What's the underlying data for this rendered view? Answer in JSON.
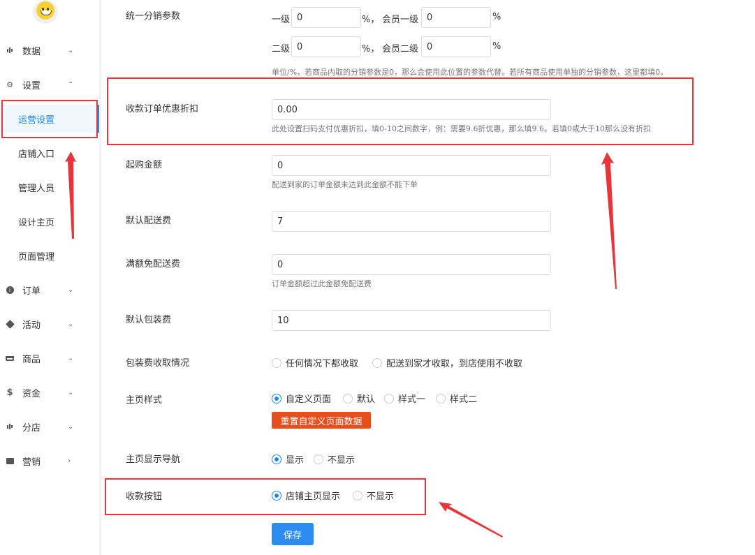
{
  "sidebar": {
    "items": [
      {
        "label": "数据",
        "icon": "bar-chart-icon"
      },
      {
        "label": "设置",
        "icon": "gear-icon"
      },
      {
        "label": "订单",
        "icon": "info-icon"
      },
      {
        "label": "活动",
        "icon": "tag-icon"
      },
      {
        "label": "商品",
        "icon": "basket-icon"
      },
      {
        "label": "资金",
        "icon": "dollar-icon"
      },
      {
        "label": "分店",
        "icon": "bar-chart-icon"
      },
      {
        "label": "营销",
        "icon": "folder-icon"
      }
    ],
    "subitems": [
      "运营设置",
      "店铺入口",
      "管理人员",
      "设计主页",
      "页面管理"
    ],
    "active_subitem": "运营设置"
  },
  "form": {
    "distribution": {
      "label": "统一分销参数",
      "level1_label": "一级",
      "level1_value": "0",
      "member_level1_label": "会员一级",
      "member_level1_value": "0",
      "level2_label": "二级",
      "level2_value": "0",
      "member_level2_label": "会员二级",
      "member_level2_value": "0",
      "percent": "%",
      "sep": "%，",
      "hint": "单位/%，若商品内取的分销参数是0，那么会使用此位置的参数代替。若所有商品使用单独的分销参数，这里都填0。"
    },
    "discount": {
      "label": "收款订单优惠折扣",
      "value": "0.00",
      "hint": "此处设置扫码支付优惠折扣，填0-10之间数字，例：需要9.6折优惠，那么填9.6。若填0或大于10那么没有折扣"
    },
    "min_amount": {
      "label": "起购金额",
      "value": "0",
      "hint": "配送到家的订单金额未达到此金额不能下单"
    },
    "delivery_fee": {
      "label": "默认配送费",
      "value": "7"
    },
    "free_delivery": {
      "label": "满额免配送费",
      "value": "0",
      "hint": "订单金额超过此金额免配送费"
    },
    "packing_fee": {
      "label": "默认包装费",
      "value": "10"
    },
    "packing_rule": {
      "label": "包装费收取情况",
      "options": [
        "任何情况下都收取",
        "配送到家才收取，到店使用不收取"
      ]
    },
    "home_style": {
      "label": "主页样式",
      "options": [
        "自定义页面",
        "默认",
        "样式一",
        "样式二"
      ],
      "selected": "自定义页面",
      "reset_button": "重置自定义页面数据"
    },
    "home_nav": {
      "label": "主页显示导航",
      "options": [
        "显示",
        "不显示"
      ],
      "selected": "显示"
    },
    "pay_button": {
      "label": "收款按钮",
      "options": [
        "店铺主页显示",
        "不显示"
      ],
      "selected": "店铺主页显示"
    },
    "save_button": "保存"
  },
  "colors": {
    "accent": "#1e88e5",
    "highlight": "#e7353a",
    "reset_button": "#e84d1c"
  }
}
